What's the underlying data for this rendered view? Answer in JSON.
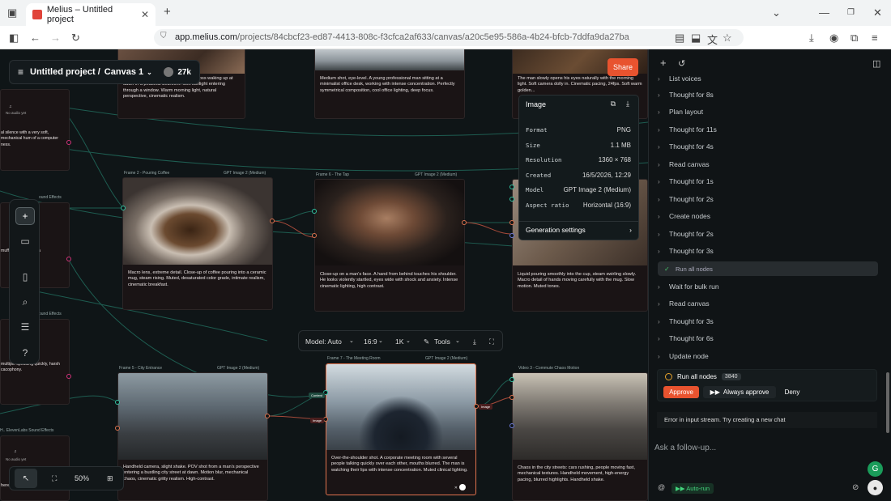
{
  "browser": {
    "tab_title": "Melius – Untitled project",
    "url_host": "app.melius.com",
    "url_path": "/projects/84cbcf23-ed87-4413-808c-f3cfca2af633/canvas/a20c5e95-586a-4b24-bfcb-7ddfa9da27ba"
  },
  "project": {
    "name": "Untitled project /",
    "canvas": "Canvas 1",
    "credits": "27k",
    "share": "Share"
  },
  "nodes": {
    "top_left_caption": "young professional man with hearing loss waking up at dawn in a peaceful bedroom. Soft sunlight entering through a window. Warm morning light, natural perspective, cinematic realism.",
    "top_mid_caption": "Medium shot, eye-level. A young professional man sitting at a minimalist office desk, working with intense concentration. Perfectly symmetrical composition, cool office lighting, deep focus.",
    "top_right_caption": "The man slowly opens his eyes naturally with the morning light. Soft camera dolly in. Cinematic pacing, 24fps. Soft warm golden...",
    "frame2_label": "Frame 2 - Pouring Coffee",
    "frame2_model": "GPT Image 2 (Medium)",
    "frame2_caption": "Macro lens, extreme detail. Close-up of coffee pouring into a ceramic mug, steam rising. Muted, desaturated color grade, intimate realism, cinematic breakfast.",
    "frame6_label": "Frame 6 - The Tap",
    "frame6_model": "GPT Image 2 (Medium)",
    "frame6_caption": "Close-up on a man's face. A hand from behind touches his shoulder. He looks violently startled, eyes wide with shock and anxiety. Intense cinematic lighting, high contrast.",
    "right_mid_caption": "Liquid pouring smoothly into the cup, steam swirling slowly. Macro detail of hands moving carefully with the mug. Slow motion. Muted tones.",
    "frame5_label": "Frame 5 - City Entrance",
    "frame5_model": "GPT Image 2 (Medium)",
    "frame5_caption": "Handheld camera, slight shake. POV shot from a man's perspective entering a bustling city street at dawn. Motion blur, mechanical chaos, cinematic gritty realism. High-contrast.",
    "frame7_label": "Frame 7 - The Meeting Room",
    "frame7_model": "GPT Image 2 (Medium)",
    "frame7_caption": "Over-the-shoulder shot. A corporate meeting room with several people talking quickly over each other, mouths blurred. The man is watching their lips with intense concentration. Muted clinical lighting.",
    "video3_label": "Video 3 - Commute Chaos Motion",
    "video3_caption": "Chaos in the city streets: cars rushing, people moving fast, mechanical textures. Handheld movement, high-energy pacing, blurred highlights. Handheld shake.",
    "audio_label_1": "No audio yet",
    "audio_label_2": "No audio yet",
    "audio_label_3": "No audio yet",
    "sound_effects_1": "ound Effects",
    "sound_effects_2": "ound Effects",
    "eleven_label": "H.. ElevenLabs Sound Effects",
    "left_text_1": "al silence with a very soft, mechanical hum of a computer ness.",
    "left_text_2": "muffl owed by ch of a",
    "left_text_3": "multiple speaking quickly, harsh cacophony.",
    "left_text_4": "here.",
    "pill_content": "Content",
    "pill_image": "Image",
    "pill_image2": "Image",
    "pill_image3": "Image"
  },
  "info_popup": {
    "title": "Image",
    "rows": [
      {
        "k": "Format",
        "v": "PNG"
      },
      {
        "k": "Size",
        "v": "1.1 MB"
      },
      {
        "k": "Resolution",
        "v": "1360 × 768"
      },
      {
        "k": "Created",
        "v": "16/5/2026, 12:29"
      },
      {
        "k": "Model",
        "v": "GPT Image 2 (Medium)"
      },
      {
        "k": "Aspect ratio",
        "v": "Horizontal (16:9)"
      }
    ],
    "gen_settings": "Generation settings"
  },
  "model_bar": {
    "model": "Model: Auto",
    "ratio": "16:9",
    "res": "1K",
    "tools": "Tools"
  },
  "zoom": {
    "value": "50%"
  },
  "panel": {
    "items": [
      "List voices",
      "Thought for 8s",
      "Plan layout",
      "Thought for 11s",
      "Thought for 4s",
      "Read canvas",
      "Thought for 1s",
      "Thought for 2s",
      "Create nodes",
      "Thought for 2s",
      "Thought for 3s",
      "Run all nodes",
      "Wait for bulk run",
      "Read canvas",
      "Thought for 3s",
      "Thought for 6s",
      "Update node"
    ],
    "approval": {
      "title": "Run all nodes",
      "cost": "3840",
      "approve": "Approve",
      "always": "Always approve",
      "deny": "Deny"
    },
    "error": "Error in input stream. Try creating a new chat",
    "ask_placeholder": "Ask a follow-up...",
    "autorun": "Auto-run"
  },
  "colors": {
    "accent": "#e8532f",
    "wire": "#1f5a50",
    "success": "#43d67d"
  }
}
